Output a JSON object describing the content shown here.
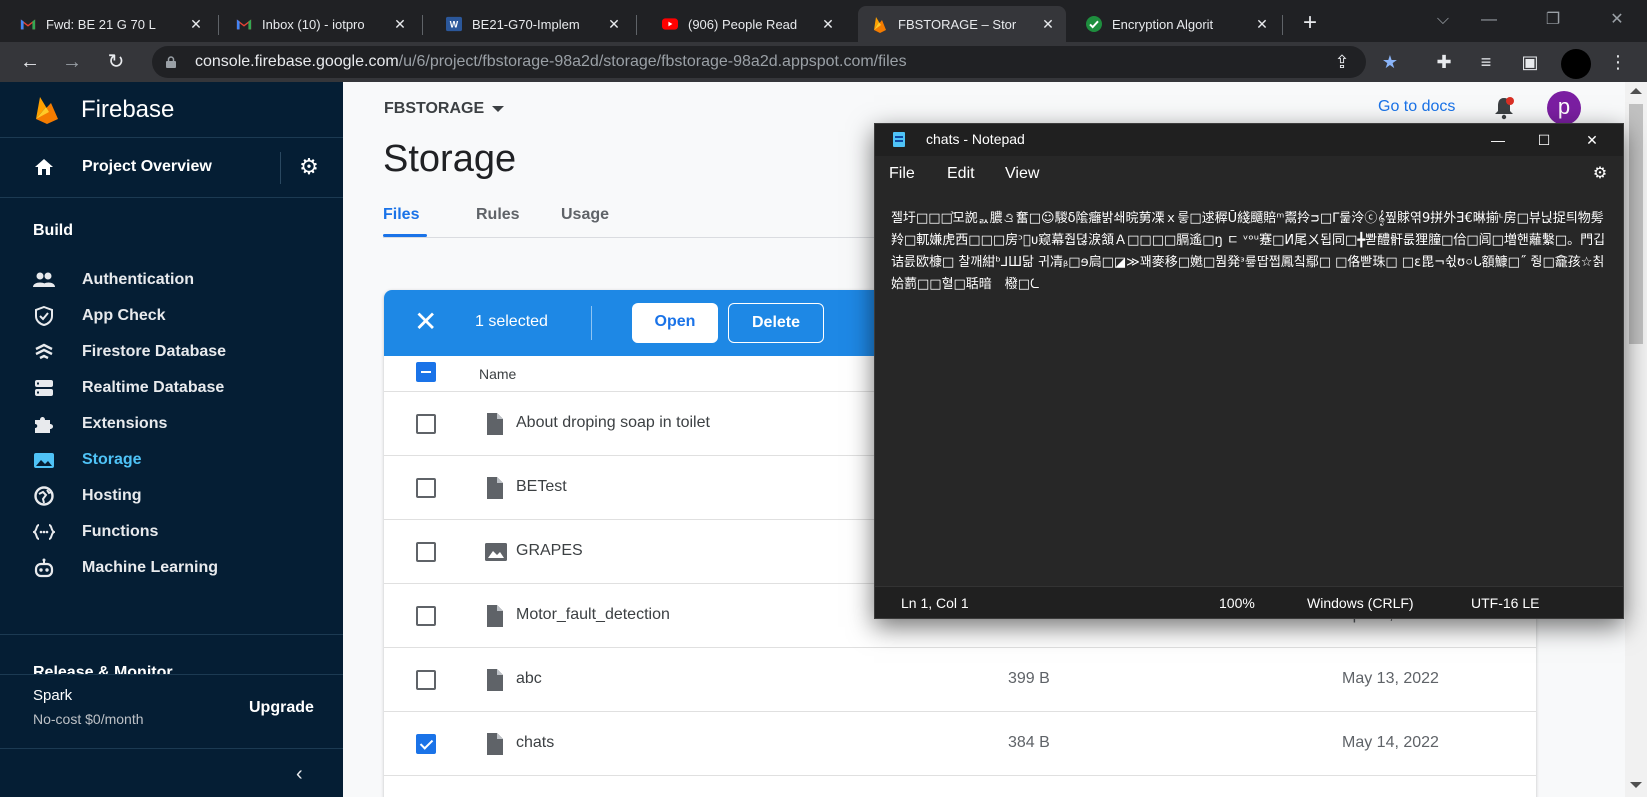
{
  "browser": {
    "tabs": [
      {
        "title": "Fwd: BE 21 G 70 L",
        "icon": "gmail-icon"
      },
      {
        "title": "Inbox (10) - iotpro",
        "icon": "gmail-icon"
      },
      {
        "title": "BE21-G70-Implem",
        "icon": "word-icon"
      },
      {
        "title": "(906) People Read",
        "icon": "youtube-icon"
      },
      {
        "title": "FBSTORAGE – Stor",
        "icon": "firebase-icon"
      },
      {
        "title": "Encryption Algorit",
        "icon": "check-icon"
      }
    ],
    "url_host": "console.firebase.google.com",
    "url_path": "/u/6/project/fbstorage-98a2d/storage/fbstorage-98a2d.appspot.com/files"
  },
  "sidebar": {
    "brand": "Firebase",
    "project_overview": "Project Overview",
    "build_label": "Build",
    "items": [
      {
        "label": "Authentication",
        "icon": "people-icon"
      },
      {
        "label": "App Check",
        "icon": "shield-icon"
      },
      {
        "label": "Firestore Database",
        "icon": "firestore-icon"
      },
      {
        "label": "Realtime Database",
        "icon": "database-icon"
      },
      {
        "label": "Extensions",
        "icon": "puzzle-icon"
      },
      {
        "label": "Storage",
        "icon": "storage-icon"
      },
      {
        "label": "Hosting",
        "icon": "globe-icon"
      },
      {
        "label": "Functions",
        "icon": "functions-icon"
      },
      {
        "label": "Machine Learning",
        "icon": "robot-icon"
      }
    ],
    "release_label": "Release & Monitor",
    "plan_name": "Spark",
    "plan_sub": "No-cost $0/month",
    "upgrade": "Upgrade"
  },
  "main": {
    "project_name": "FBSTORAGE",
    "docs_link": "Go to docs",
    "avatar_letter": "p",
    "title": "Storage",
    "tabs": [
      "Files",
      "Rules",
      "Usage"
    ],
    "selection": {
      "count_label": "1 selected",
      "open": "Open",
      "delete": "Delete"
    },
    "name_header": "Name",
    "files": [
      {
        "name": "About droping soap in toilet",
        "size": "",
        "date": "",
        "type": "file",
        "checked": false
      },
      {
        "name": "BETest",
        "size": "",
        "date": "",
        "type": "file",
        "checked": false
      },
      {
        "name": "GRAPES",
        "size": "",
        "date": "",
        "type": "image",
        "checked": false
      },
      {
        "name": "Motor_fault_detection",
        "size": "1.9 MB",
        "date": "Apr 30, 2022",
        "type": "file",
        "checked": false
      },
      {
        "name": "abc",
        "size": "399 B",
        "date": "May 13, 2022",
        "type": "file",
        "checked": false
      },
      {
        "name": "chats",
        "size": "384 B",
        "date": "May 14, 2022",
        "type": "file",
        "checked": true
      }
    ]
  },
  "notepad": {
    "title": "chats - Notepad",
    "menu": [
      "File",
      "Edit",
      "View"
    ],
    "content": "젤圩□□□ꙸ모䛄ᆳ膿ࡠ奮□☺騣ẟ隂癰밝쇄晥莮凓ｘ릏□逑稺Ū綫飅賠ᵐ鬻拎ᴝ□ᒥ룵泠ⓒ𝄞찦賕엮9拼外Ǝ€晽揃ᶫ房□뷰닍捉틔物髣羚□軏嫌虎西□□□房ᵓ⃠ᴜ窥幕줩뎒涙頷Ａ□□□□膈遙□ŋ ㄷ ᵛᵒᵘ蹇□Ͷ尾ㄨ됩同□╋뽣醴骭룺狸膧□佮□闾□増핸蘺繫□。門깁诘릀欧槺□ 찰깨紺ᵇ⅃Ш닮 귀凊ᵦ□ɘ扃□◪≫꽤麥移□嬎□뭠発ᵌ륳땁쩝鳳칰鄢□ □佫빧珠□ □ɛ毘¬쉯ʊ০ᒐ額鱇□˝ 줭□龕孩☆칡姶藅□□혈□聒暗　橃□ᘇ"
  },
  "notepad_status": {
    "position": "Ln 1, Col 1",
    "zoom": "100%",
    "line_ending": "Windows (CRLF)",
    "encoding": "UTF-16 LE"
  }
}
